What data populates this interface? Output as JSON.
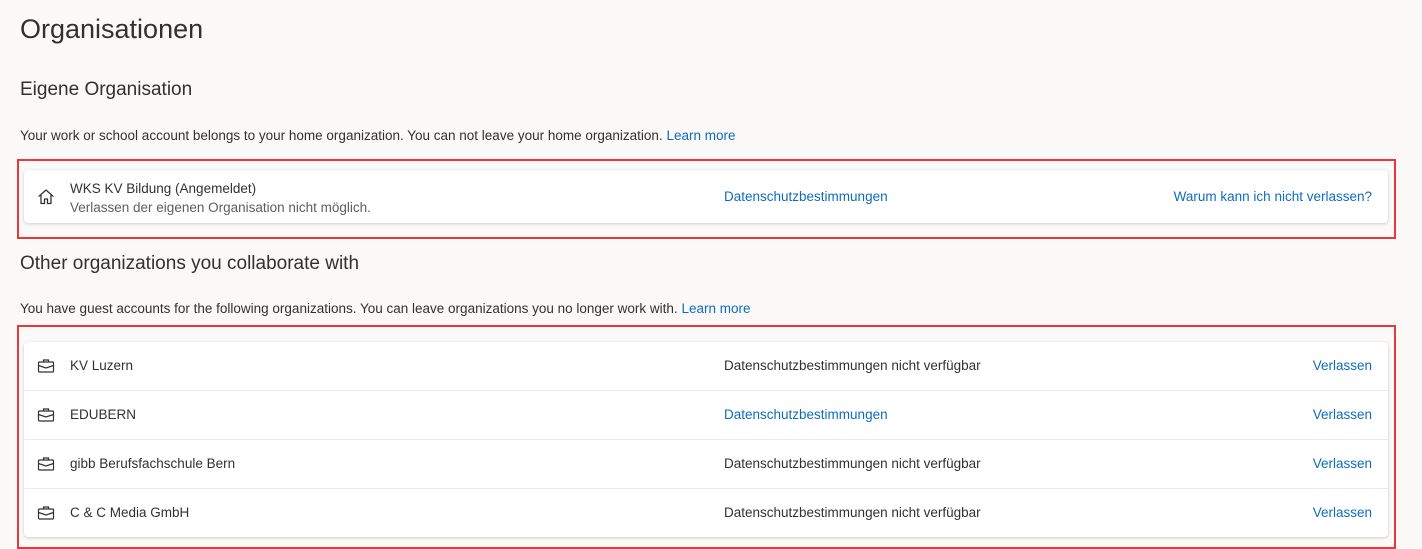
{
  "page": {
    "title": "Organisationen"
  },
  "home": {
    "title": "Eigene Organisation",
    "description": "Your work or school account belongs to your home organization. You can not leave your home organization.",
    "learn_more": "Learn more",
    "org": {
      "name": "WKS KV Bildung (Angemeldet)",
      "subtitle": "Verlassen der eigenen Organisation nicht möglich.",
      "privacy": "Datenschutzbestimmungen",
      "action": "Warum kann ich nicht verlassen?",
      "icon": "home-icon"
    }
  },
  "others": {
    "title": "Other organizations you collaborate with",
    "description": "You have guest accounts for the following organizations. You can leave organizations you no longer work with.",
    "learn_more": "Learn more",
    "orgs": [
      {
        "name": "KV Luzern",
        "privacy": "Datenschutzbestimmungen nicht verfügbar",
        "privacy_is_link": false,
        "action": "Verlassen",
        "icon": "briefcase-icon"
      },
      {
        "name": "EDUBERN",
        "privacy": "Datenschutzbestimmungen",
        "privacy_is_link": true,
        "action": "Verlassen",
        "icon": "briefcase-icon"
      },
      {
        "name": "gibb Berufsfachschule Bern",
        "privacy": "Datenschutzbestimmungen nicht verfügbar",
        "privacy_is_link": false,
        "action": "Verlassen",
        "icon": "briefcase-icon"
      },
      {
        "name": "C & C Media GmbH",
        "privacy": "Datenschutzbestimmungen nicht verfügbar",
        "privacy_is_link": false,
        "action": "Verlassen",
        "icon": "briefcase-icon"
      }
    ]
  },
  "colors": {
    "link": "#0f6cbd",
    "highlight_border": "#e8383d",
    "background": "#faf9f8"
  }
}
